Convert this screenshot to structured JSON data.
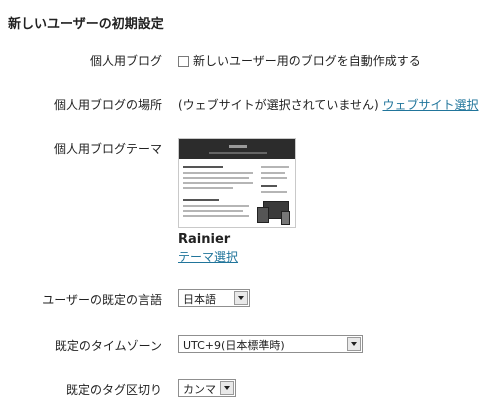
{
  "section_title": "新しいユーザーの初期設定",
  "personal_blog": {
    "label": "個人用ブログ",
    "checkbox_label": "新しいユーザー用のブログを自動作成する",
    "checked": false
  },
  "blog_location": {
    "label": "個人用ブログの場所",
    "status_text": "(ウェブサイトが選択されていません)",
    "link_text": "ウェブサイト選択"
  },
  "blog_theme": {
    "label": "個人用ブログテーマ",
    "theme_name": "Rainier",
    "link_text": "テーマ選択"
  },
  "language": {
    "label": "ユーザーの既定の言語",
    "value": "日本語"
  },
  "timezone": {
    "label": "既定のタイムゾーン",
    "value": "UTC+9(日本標準時)"
  },
  "tag_delimiter": {
    "label": "既定のタグ区切り",
    "value": "カンマ"
  }
}
